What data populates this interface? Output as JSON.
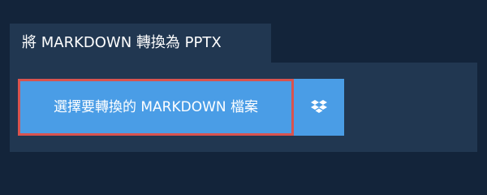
{
  "header": {
    "tab_title": "將 MARKDOWN 轉換為 PPTX"
  },
  "upload": {
    "select_label": "選擇要轉換的 MARKDOWN 檔案",
    "dropbox_icon": "dropbox-icon"
  },
  "colors": {
    "page_background": "#13243a",
    "panel_background": "#213751",
    "button_background": "#4a9de6",
    "focus_border": "#d9534f",
    "text": "#ffffff"
  }
}
